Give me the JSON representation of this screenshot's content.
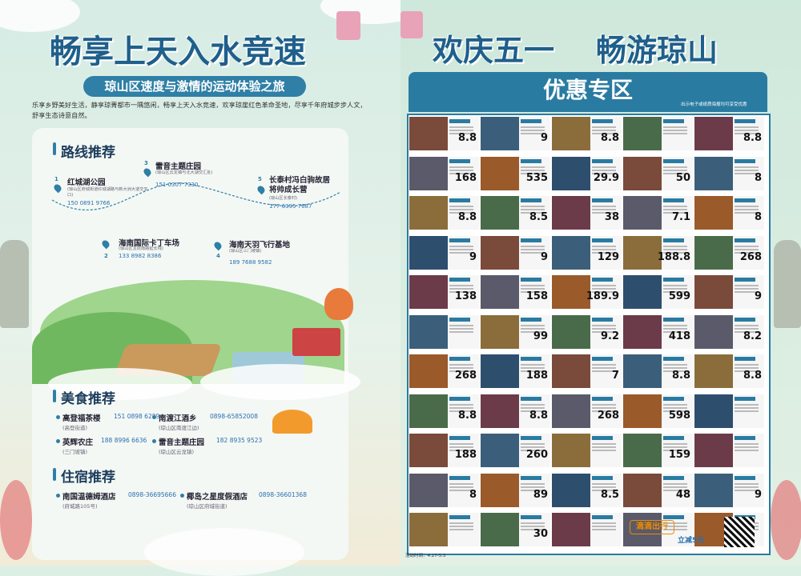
{
  "left": {
    "title": "畅享上天入水竞速",
    "subtitle": "琼山区速度与激情的运动体验之旅",
    "intro": "乐享乡野美好生活，静享琼菁都市一隅悠闲，畅享上天入水竞速，欢享琼崖红色革命圣地，尽享千年府城步步人文，舒享生态诗意自然。",
    "routes_heading": "路线推荐",
    "routes": [
      {
        "num": "1",
        "name": "红城湖公园",
        "note": "(琼山区府城街道红城湖路与新大洲大道交叉口)",
        "tel": "150 0891 9766"
      },
      {
        "num": "2",
        "name": "海南国际卡丁车场",
        "note": "(琼山区龙昆南路延长线)",
        "tel": "133 8982 8386"
      },
      {
        "num": "3",
        "name": "雷音主题庄园",
        "note": "(琼山区云龙镇与北大湖交汇处)",
        "tel": "151 0307 7330"
      },
      {
        "num": "4",
        "name": "海南天羽飞行基地",
        "note": "(琼山区三门坡镇)",
        "tel": "189 7688 9582"
      },
      {
        "num": "5",
        "name": "长泰村冯白驹故居 将帅成长营",
        "note": "(琼山区长泰村)",
        "tel": "177 6395 7687"
      }
    ],
    "food_heading": "美食推荐",
    "foods": [
      {
        "name": "高登福茶楼",
        "tel": "151 0898 6289",
        "addr": "(高登街道)"
      },
      {
        "name": "南渡江酒乡",
        "tel": "0898-65852008",
        "addr": "(琼山区南渡江边)"
      },
      {
        "name": "英辉农庄",
        "tel": "188 8996 6636",
        "addr": "(三门坡镇)"
      },
      {
        "name": "雷音主题庄园",
        "tel": "182 8935 9523",
        "addr": "(琼山区云龙镇)"
      }
    ],
    "stay_heading": "住宿推荐",
    "stays": [
      {
        "name": "南国温德姆酒店",
        "tel": "0898-36695666",
        "addr": "(府城路105号)"
      },
      {
        "name": "椰岛之星度假酒店",
        "tel": "0898-36601368",
        "addr": "(琼山区府城街道)"
      }
    ]
  },
  "right": {
    "title_a": "欢庆五一",
    "title_b": "畅游琼山",
    "banner": "优惠专区",
    "banner_note": "出示电子或纸质海报均可享受优惠",
    "prices": [
      [
        "8.8",
        "9",
        "8.8",
        "",
        "8.8"
      ],
      [
        "168",
        "535",
        "29.9",
        "50",
        "8"
      ],
      [
        "8.8",
        "8.5",
        "38",
        "7.1",
        "8"
      ],
      [
        "9",
        "9",
        "129",
        "188.8",
        "268"
      ],
      [
        "138",
        "158",
        "189.9",
        "599",
        "9"
      ],
      [
        "",
        "99",
        "9.2",
        "418",
        "8.2"
      ],
      [
        "268",
        "188",
        "7",
        "8.8",
        "8.8"
      ],
      [
        "8.8",
        "8.8",
        "268",
        "598",
        ""
      ],
      [
        "188",
        "260",
        "",
        "159",
        ""
      ],
      [
        "8",
        "89",
        "8.5",
        "48",
        "9"
      ],
      [
        "",
        "30",
        "",
        "",
        ""
      ]
    ],
    "didi_label": "滴滴出行",
    "didi_offer": "立减5元",
    "footer": "活动时间：4.27-5.5"
  }
}
